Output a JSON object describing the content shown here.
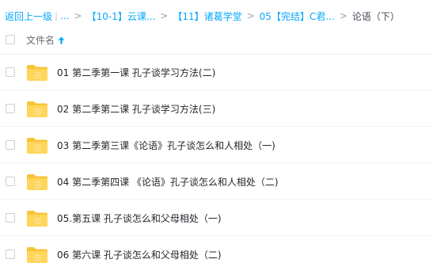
{
  "breadcrumb": {
    "back_label": "返回上一级",
    "ellipsis": "...",
    "items": [
      "【10-1】云课...",
      "【11】诸葛学堂",
      "05【完结】C君..."
    ],
    "current": "论语（下）",
    "separator": ">",
    "pipe": "|"
  },
  "table": {
    "column_name": "文件名",
    "sort": "ascending"
  },
  "files": [
    {
      "name": "01 第二季第一课 孔子谈学习方法(二)",
      "type": "folder"
    },
    {
      "name": "02 第二季第二课 孔子谈学习方法(三)",
      "type": "folder"
    },
    {
      "name": "03 第二季第三课《论语》孔子谈怎么和人相处（一)",
      "type": "folder"
    },
    {
      "name": "04 第二季第四课 《论语》孔子谈怎么和人相处（二)",
      "type": "folder"
    },
    {
      "name": "05.第五课 孔子谈怎么和父母相处（一)",
      "type": "folder"
    },
    {
      "name": "06 第六课 孔子谈怎么和父母相处（二)",
      "type": "folder"
    }
  ],
  "colors": {
    "accent": "#06a7ff",
    "folder_body": "#ffd55a",
    "folder_tab": "#f7c437",
    "folder_inner": "#fbe7a6"
  },
  "icons": {
    "sort": "arrow-up-icon",
    "file": "folder-icon"
  }
}
